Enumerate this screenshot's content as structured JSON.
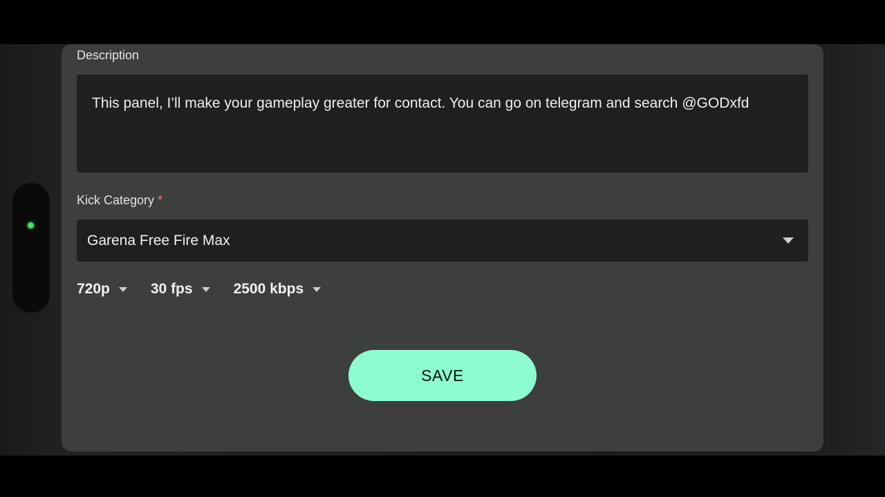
{
  "colors": {
    "accent": "#8dfcd1",
    "required": "#ff6b6b",
    "status_dot": "#3ee06a"
  },
  "form": {
    "description": {
      "label": "Description",
      "value": "This panel, I’ll make your gameplay greater for contact. You can go on telegram and search @GODxfd"
    },
    "category": {
      "label": "Kick Category",
      "required_mark": "*",
      "selected": "Garena Free Fire Max",
      "icon": "caret-down-icon"
    },
    "quality": {
      "resolution": "720p",
      "framerate": "30 fps",
      "bitrate": "2500 kbps"
    },
    "save_label": "SAVE"
  }
}
